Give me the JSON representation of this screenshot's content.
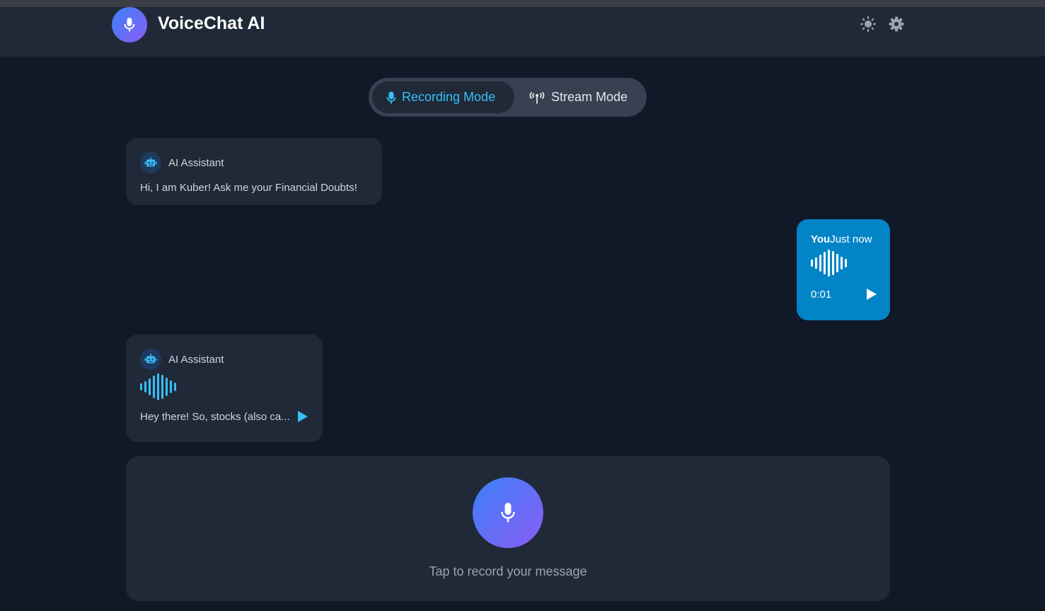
{
  "app": {
    "title": "VoiceChat AI"
  },
  "header": {
    "icons": [
      "sun-icon",
      "gear-icon"
    ]
  },
  "modes": {
    "recording_label": "Recording Mode",
    "stream_label": "Stream Mode",
    "active": "Recording Mode"
  },
  "messages": [
    {
      "sender": "AI Assistant",
      "type": "text",
      "text": "Hi, I am Kuber! Ask me your Financial Doubts!"
    },
    {
      "sender": "You",
      "time": "Just now",
      "type": "audio",
      "duration": "0:01"
    },
    {
      "sender": "AI Assistant",
      "type": "audio",
      "text": "Hey there! So, stocks (also ca..."
    }
  ],
  "recorder": {
    "hint": "Tap to record your message"
  },
  "colors": {
    "background": "#111827",
    "panel": "#1f2937",
    "accent": "#38bdf8",
    "user_bubble": "#0284c7",
    "gradient_start": "#3b82f6",
    "gradient_end": "#8b5cf6"
  }
}
